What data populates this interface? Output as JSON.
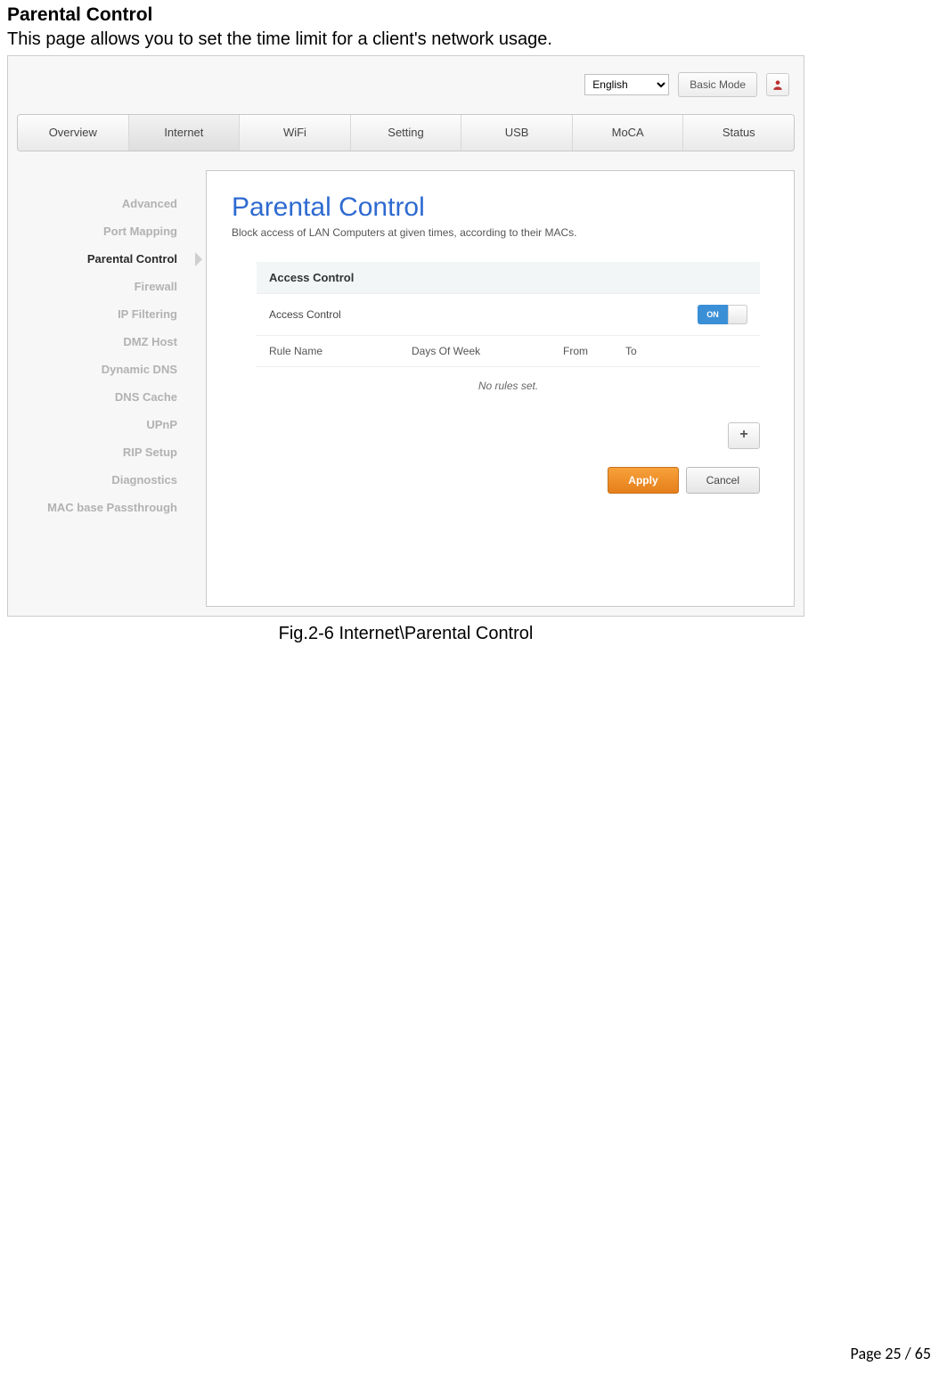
{
  "doc": {
    "section_title": "Parental Control",
    "description": "This page allows you to set the time limit for a client's network usage.",
    "caption": "Fig.2-6 Internet\\Parental Control",
    "page_label": "Page 25 / 65"
  },
  "topbar": {
    "language": "English",
    "mode_button": "Basic Mode"
  },
  "tabs": [
    "Overview",
    "Internet",
    "WiFi",
    "Setting",
    "USB",
    "MoCA",
    "Status"
  ],
  "active_tab_index": 1,
  "sidebar": {
    "items": [
      "Advanced",
      "Port Mapping",
      "Parental Control",
      "Firewall",
      "IP Filtering",
      "DMZ Host",
      "Dynamic DNS",
      "DNS Cache",
      "UPnP",
      "RIP Setup",
      "Diagnostics",
      "MAC base Passthrough"
    ],
    "active_index": 2
  },
  "content": {
    "title": "Parental Control",
    "subtitle": "Block access of LAN Computers at given times, according to their MACs.",
    "section_header": "Access Control",
    "toggle_row_label": "Access Control",
    "toggle_state": "ON",
    "columns": [
      "Rule Name",
      "Days Of Week",
      "From",
      "To"
    ],
    "empty_text": "No rules set.",
    "add_label": "+",
    "apply_label": "Apply",
    "cancel_label": "Cancel"
  }
}
